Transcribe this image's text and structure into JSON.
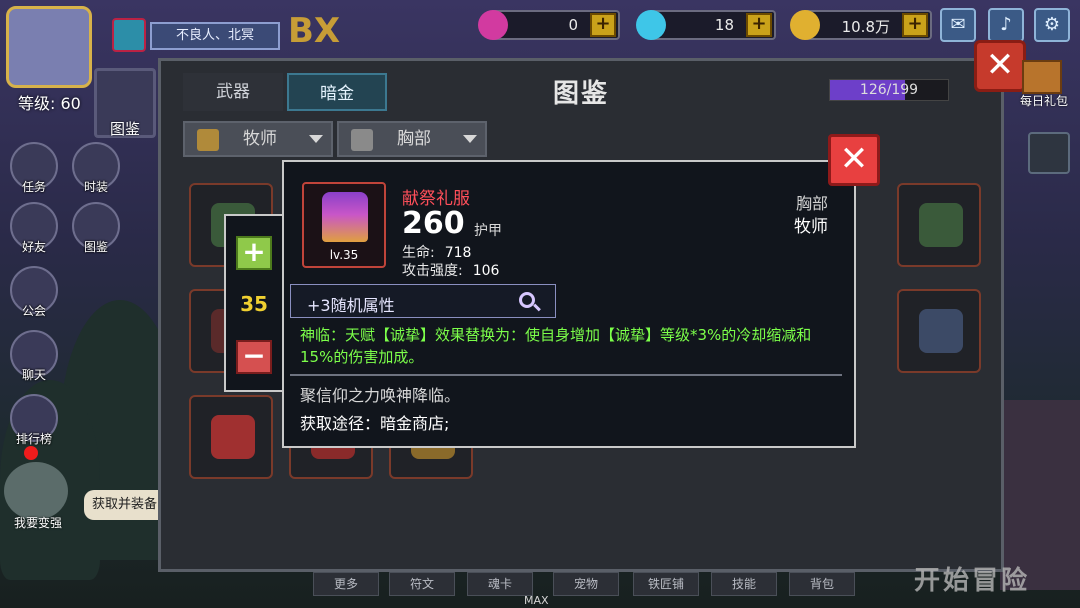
{
  "player": {
    "level_label": "等级: 60",
    "name_banner": "不良人、北冥",
    "bx_badge": "BX"
  },
  "resources": [
    {
      "icon": "ruby-gem-icon",
      "value": "0",
      "color": "#d23aa0"
    },
    {
      "icon": "diamond-icon",
      "value": "18",
      "color": "#3ec6e8"
    },
    {
      "icon": "gold-coin-icon",
      "value": "10.8万",
      "color": "#e0b030"
    }
  ],
  "top_icons": [
    "mail-icon",
    "speaker-icon",
    "settings-gear-icon"
  ],
  "left_sidebar": {
    "codex_label": "图鉴",
    "items": [
      {
        "name": "task",
        "label": "任务"
      },
      {
        "name": "costume",
        "label": "时装"
      },
      {
        "name": "friends",
        "label": "好友"
      },
      {
        "name": "codex",
        "label": "图鉴"
      },
      {
        "name": "guild",
        "label": "公会"
      },
      {
        "name": "chat",
        "label": "聊天"
      },
      {
        "name": "ranking",
        "label": "排行榜"
      }
    ],
    "promo_label": "我要变强",
    "tooltip_text": "获取并装备"
  },
  "panel": {
    "tabs": [
      {
        "label": "武器",
        "active": false
      },
      {
        "label": "暗金",
        "active": true
      }
    ],
    "title": "图鉴",
    "progress_text": "126/199",
    "progress_value": 0.633,
    "filters": [
      {
        "label": "牧师",
        "icon": "staff-icon"
      },
      {
        "label": "胸部",
        "icon": "chest-armor-icon"
      }
    ]
  },
  "right_side": {
    "daily_gift_label": "每日礼包"
  },
  "item_detail": {
    "name": "献祭礼服",
    "score": "260",
    "score_label": "护甲",
    "level": "lv.35",
    "stats": [
      {
        "label": "生命:",
        "value": "718"
      },
      {
        "label": "攻击强度:",
        "value": "106"
      }
    ],
    "slot_type": "胸部",
    "class_type": "牧师",
    "random_attr": "+3随机属性",
    "effect": "神临：天赋【诚挚】效果替换为：使自身增加【诚挚】等级*3%的冷却缩减和15%的伤害加成。",
    "description": "聚信仰之力唤神降临。",
    "source": "获取途径：暗金商店;"
  },
  "quantity": {
    "value": "35"
  },
  "bottom_menu": [
    "更多",
    "符文",
    "魂卡",
    "宠物",
    "铁匠铺",
    "技能",
    "背包"
  ],
  "max_label": "MAX",
  "game_title": "开始冒险"
}
